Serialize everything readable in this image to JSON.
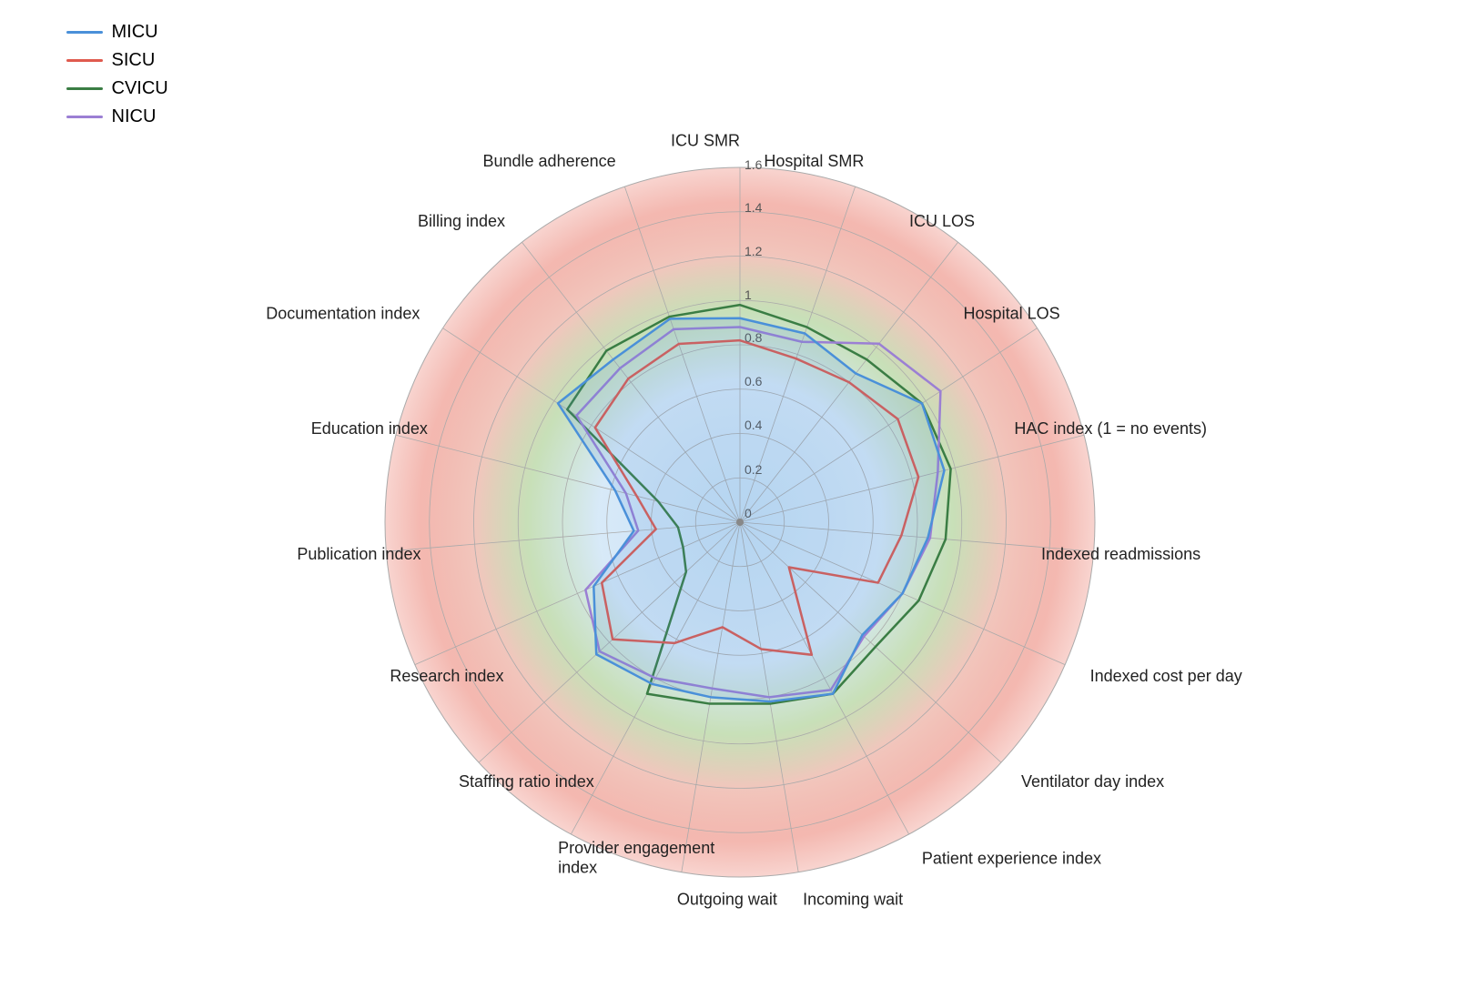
{
  "legend": {
    "items": [
      {
        "label": "MICU",
        "color": "#4a90d9"
      },
      {
        "label": "SICU",
        "color": "#e05a4e"
      },
      {
        "label": "CVICU",
        "color": "#3a7d44"
      },
      {
        "label": "NICU",
        "color": "#9b7fd4"
      }
    ]
  },
  "axes": [
    {
      "label": "ICU SMR",
      "angle": 90
    },
    {
      "label": "Hospital SMR",
      "angle": 66
    },
    {
      "label": "ICU LOS",
      "angle": 42
    },
    {
      "label": "Hospital LOS",
      "angle": 18
    },
    {
      "label": "HAC index (1 = no events)",
      "angle": -6
    },
    {
      "label": "Indexed readmissions",
      "angle": -30
    },
    {
      "label": "Indexed cost per day",
      "angle": -54
    },
    {
      "label": "Ventilator day index",
      "angle": -78
    },
    {
      "label": "Patient experience index",
      "angle": -102
    },
    {
      "label": "Incoming wait",
      "angle": -126
    },
    {
      "label": "Outgoing wait",
      "angle": -150
    },
    {
      "label": "Provider engagement index",
      "angle": -174
    },
    {
      "label": "Staffing ratio index",
      "angle": 162
    },
    {
      "label": "Research index",
      "angle": 138
    },
    {
      "label": "Publication index",
      "angle": 114
    },
    {
      "label": "Education index",
      "angle": 90
    },
    {
      "label": "Documentation index",
      "angle": 66
    },
    {
      "label": "Billing index",
      "angle": 42
    },
    {
      "label": "Bundle adherence",
      "angle": 18
    }
  ],
  "radial_labels": [
    "0",
    "0.2",
    "0.4",
    "0.6",
    "0.8",
    "1",
    "1.2",
    "1.4",
    "1.6"
  ],
  "series": {
    "MICU": {
      "color": "#4a90d9",
      "values": [
        0.95,
        0.92,
        0.9,
        1.0,
        0.95,
        0.85,
        0.8,
        0.75,
        0.9,
        0.85,
        0.8,
        0.85,
        0.9,
        0.75,
        0.5,
        0.6,
        1.0,
        0.95,
        1.0
      ]
    },
    "SICU": {
      "color": "#e05a4e",
      "values": [
        0.85,
        0.8,
        0.82,
        0.88,
        0.85,
        0.75,
        0.7,
        0.3,
        0.7,
        0.6,
        0.5,
        0.65,
        0.8,
        0.7,
        0.4,
        0.5,
        0.8,
        0.85,
        0.88
      ]
    },
    "CVICU": {
      "color": "#3a7d44",
      "values": [
        1.0,
        0.95,
        0.95,
        1.0,
        1.0,
        0.95,
        0.9,
        0.85,
        0.9,
        0.85,
        0.85,
        0.9,
        0.35,
        0.3,
        0.3,
        0.4,
        0.95,
        1.0,
        1.0
      ]
    },
    "NICU": {
      "color": "#9b7fd4",
      "values": [
        0.9,
        0.88,
        1.05,
        1.1,
        0.95,
        0.88,
        0.82,
        0.78,
        0.88,
        0.82,
        0.78,
        0.82,
        0.88,
        0.78,
        0.48,
        0.55,
        0.9,
        0.9,
        0.95
      ]
    }
  }
}
